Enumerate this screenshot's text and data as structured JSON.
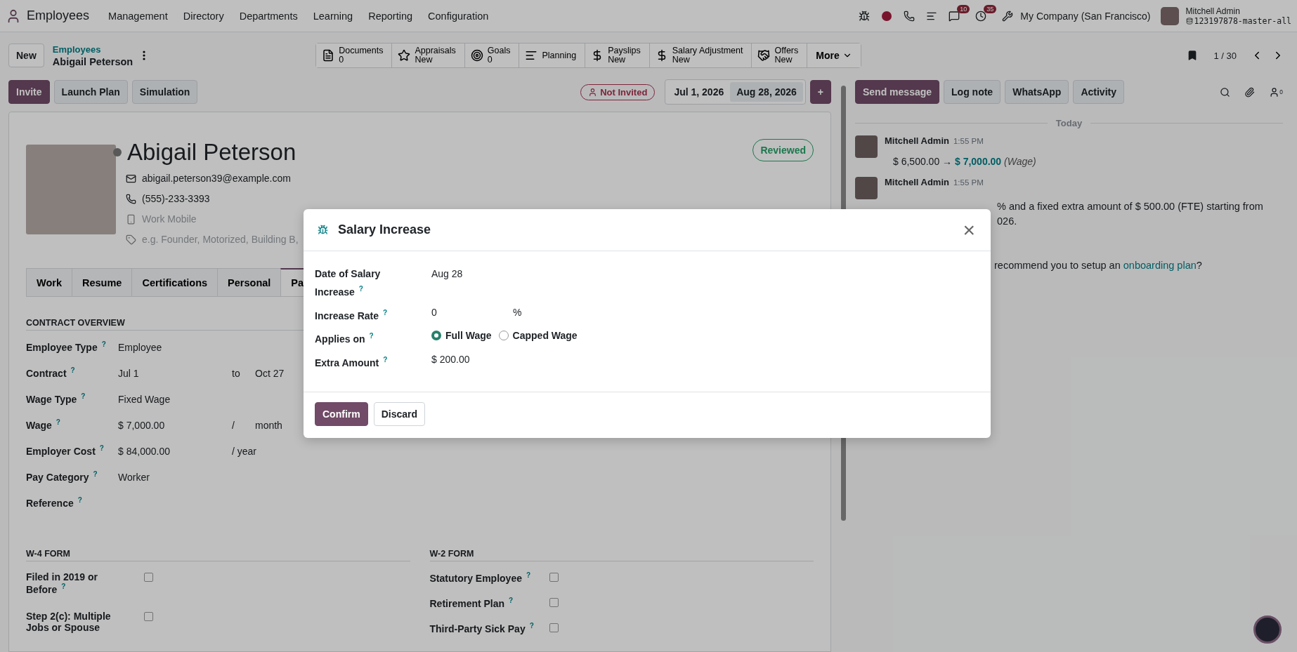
{
  "navbar": {
    "app_name": "Employees",
    "menu": [
      "Management",
      "Directory",
      "Departments",
      "Learning",
      "Reporting",
      "Configuration"
    ],
    "messages_count": "10",
    "activities_count": "35",
    "company": "My Company (San Francisco)",
    "user_name": "Mitchell Admin",
    "database": "123197878-master-all"
  },
  "control_panel": {
    "new_button": "New",
    "breadcrumb_parent": "Employees",
    "breadcrumb_current": "Abigail Peterson",
    "pager": "1 / 30"
  },
  "smart_buttons": [
    {
      "kind": "doc",
      "label": "Documents",
      "value": "0"
    },
    {
      "kind": "star",
      "label": "Appraisals",
      "value": "New"
    },
    {
      "kind": "target",
      "label": "Goals",
      "value": "0"
    },
    {
      "kind": "lines",
      "label": "Planning"
    },
    {
      "kind": "dollar",
      "label": "Payslips",
      "value": "New"
    },
    {
      "kind": "dollar",
      "label": "Salary Adjustment",
      "value": "New"
    },
    {
      "kind": "handshake",
      "label": "Offers",
      "value": "New"
    },
    {
      "kind": "more",
      "label": "More"
    }
  ],
  "actions": [
    {
      "label": "Invite",
      "primary": true
    },
    {
      "label": "Launch Plan",
      "primary": false
    },
    {
      "label": "Simulation",
      "primary": false
    }
  ],
  "invite_status": "Not Invited",
  "date_range": {
    "start": "Jul 1, 2026",
    "end": "Aug 28, 2026"
  },
  "add_button": "+",
  "employee": {
    "name": "Abigail Peterson",
    "online": false,
    "email": "abigail.peterson39@example.com",
    "phone": "(555)-233-3393",
    "work_mobile_placeholder": "Work Mobile",
    "tags_placeholder": "e.g. Founder, Motorized, Building B,",
    "status_badge": "Reviewed"
  },
  "tabs": [
    {
      "label": "Work",
      "selected": false
    },
    {
      "label": "Resume",
      "selected": false
    },
    {
      "label": "Certifications",
      "selected": false
    },
    {
      "label": "Personal",
      "selected": false
    },
    {
      "label": "Pa",
      "selected": true
    }
  ],
  "contract_overview": {
    "title": "CONTRACT OVERVIEW",
    "fields": [
      {
        "label": "Employee Type",
        "help": "?",
        "value": "Employee"
      },
      {
        "label": "Contract",
        "help": "?",
        "value": "Jul 1",
        "separator": "to",
        "value_2": "Oct 27"
      },
      {
        "label": "Wage Type",
        "help": "?",
        "value": "Fixed Wage"
      },
      {
        "label": "Wage",
        "help": "?",
        "value": "$ 7,000.00",
        "separator": "/",
        "value_2": "month"
      },
      {
        "label": "Employer Cost",
        "help": "?",
        "value": "$ 84,000.00",
        "separator": "/ year"
      },
      {
        "label": "Pay Category",
        "help": "?",
        "value": "Worker"
      },
      {
        "label": "Reference",
        "help": "?"
      }
    ]
  },
  "w4_form": {
    "title": "W-4 FORM",
    "fields": [
      {
        "label": "Filed in 2019 or Before",
        "help": "?",
        "checked": false
      },
      {
        "label": "Step 2(c): Multiple Jobs or Spouse",
        "checked": false
      }
    ]
  },
  "w2_form": {
    "title": "W-2 FORM",
    "fields": [
      {
        "label": "Statutory Employee",
        "help": "?",
        "checked": false
      },
      {
        "label": "Retirement Plan",
        "help": "?",
        "checked": false
      },
      {
        "label": "Third-Party Sick Pay",
        "help": "?",
        "checked": false
      }
    ]
  },
  "chatter": {
    "buttons": [
      {
        "label": "Send message",
        "selected": true
      },
      {
        "label": "Log note",
        "selected": false
      },
      {
        "label": "WhatsApp",
        "selected": false
      },
      {
        "label": "Activity",
        "selected": false
      }
    ],
    "followers_count": "0",
    "date_separator": "Today",
    "messages": [
      {
        "author": "Mitchell Admin",
        "time": "1:55 PM",
        "body": "$ 6,500.00 → **$ 7,000.00** *(Wage)*"
      },
      {
        "author": "Mitchell Admin",
        "time": "1:55 PM",
        "lines": [
          "% and a fixed extra amount of $ 500.00 (FTE) starting from",
          "026."
        ]
      }
    ],
    "hint": {
      "before": "recommend you to setup an",
      "link": "onboarding plan",
      "after": "?"
    }
  },
  "dialog": {
    "title": "Salary Increase",
    "close": "×",
    "fields": [
      {
        "kind": "text",
        "label": "Date of Salary Increase",
        "help": "?",
        "value": "Aug 28"
      },
      {
        "kind": "percent",
        "label": "Increase Rate",
        "help": "?",
        "value": "0",
        "unit": "%"
      },
      {
        "kind": "radio",
        "label": "Applies on",
        "help": "?",
        "options": [
          {
            "label": "Full Wage",
            "selected": true
          },
          {
            "label": "Capped Wage",
            "selected": false
          }
        ]
      },
      {
        "kind": "text",
        "label": "Extra Amount",
        "help": "?",
        "value": "$ 200.00"
      }
    ],
    "confirm": "Confirm",
    "discard": "Discard"
  }
}
